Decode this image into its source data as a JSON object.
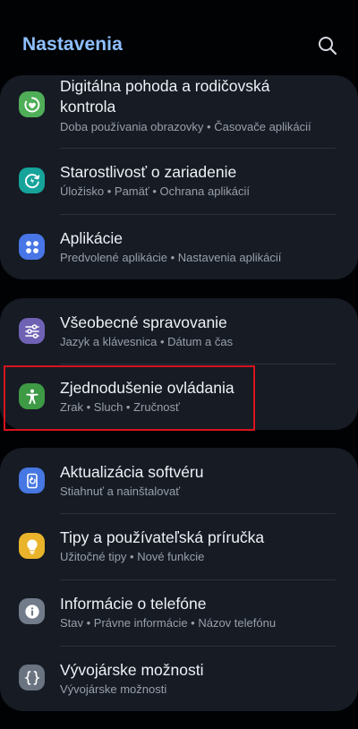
{
  "header": {
    "title": "Nastavenia",
    "search_icon": "search-icon"
  },
  "colors": {
    "background": "#010204",
    "card": "#161b24",
    "title_accent": "#8ec0ff",
    "highlight": "#d8141c"
  },
  "groups": [
    {
      "items": [
        {
          "title_line1": "Digitálna pohoda a rodičovská",
          "title_line2": "kontrola",
          "subtitle": "Doba používania obrazovky • Časovače aplikácií",
          "icon": "heart-circle-icon",
          "icon_color": "#4fae57"
        },
        {
          "title": "Starostlivosť o zariadenie",
          "subtitle": "Úložisko • Pamäť • Ochrana aplikácií",
          "icon": "device-care-icon",
          "icon_color": "#16a39a"
        },
        {
          "title": "Aplikácie",
          "subtitle": "Predvolené aplikácie • Nastavenia aplikácií",
          "icon": "apps-grid-icon",
          "icon_color": "#4876e6"
        }
      ]
    },
    {
      "items": [
        {
          "title": "Všeobecné spravovanie",
          "subtitle": "Jazyk a klávesnica • Dátum a čas",
          "icon": "sliders-icon",
          "icon_color": "#6f62b5"
        },
        {
          "title": "Zjednodušenie ovládania",
          "subtitle": "Zrak • Sluch • Zručnosť",
          "icon": "accessibility-icon",
          "icon_color": "#3e9a45"
        }
      ]
    },
    {
      "items": [
        {
          "title": "Aktualizácia softvéru",
          "subtitle": "Stiahnuť a nainštalovať",
          "icon": "software-update-icon",
          "icon_color": "#4677e2"
        },
        {
          "title": "Tipy a používateľská príručka",
          "subtitle": "Užitočné tipy • Nové funkcie",
          "icon": "lightbulb-icon",
          "icon_color": "#e9b42b"
        },
        {
          "title": "Informácie o telefóne",
          "subtitle": "Stav • Právne informácie • Názov telefónu",
          "icon": "info-icon",
          "icon_color": "#727b89"
        },
        {
          "title": "Vývojárske možnosti",
          "subtitle": "Vývojárske možnosti",
          "icon": "braces-icon",
          "icon_color": "#6a7380"
        }
      ]
    }
  ]
}
